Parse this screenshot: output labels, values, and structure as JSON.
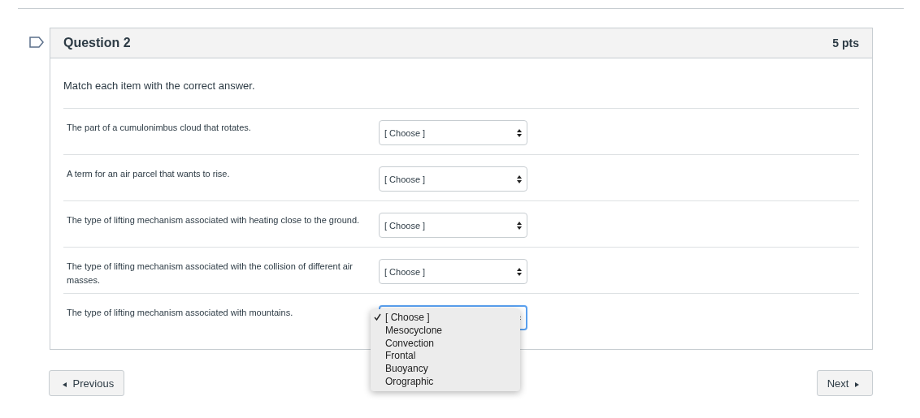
{
  "question": {
    "title": "Question 2",
    "points": "5 pts",
    "instruction": "Match each item with the correct answer."
  },
  "rows": [
    {
      "prompt": "The part of a cumulonimbus cloud that rotates.",
      "answer": "[ Choose ]",
      "focused": false
    },
    {
      "prompt": "A term for an air parcel that wants to rise.",
      "answer": "[ Choose ]",
      "focused": false
    },
    {
      "prompt": "The type of lifting mechanism associated with heating close to the ground.",
      "answer": "[ Choose ]",
      "focused": false
    },
    {
      "prompt": "The type of lifting mechanism associated with the collision of different air masses.",
      "answer": "[ Choose ]",
      "focused": false
    },
    {
      "prompt": "The type of lifting mechanism associated with mountains.",
      "focused": true,
      "menu": {
        "options": [
          {
            "label": "[ Choose ]",
            "selected": true
          },
          {
            "label": "Mesocyclone",
            "selected": false
          },
          {
            "label": "Convection",
            "selected": false
          },
          {
            "label": "Frontal",
            "selected": false
          },
          {
            "label": "Buoyancy",
            "selected": false
          },
          {
            "label": "Orographic",
            "selected": false
          }
        ]
      }
    }
  ],
  "nav": {
    "previous": "Previous",
    "next": "Next"
  }
}
